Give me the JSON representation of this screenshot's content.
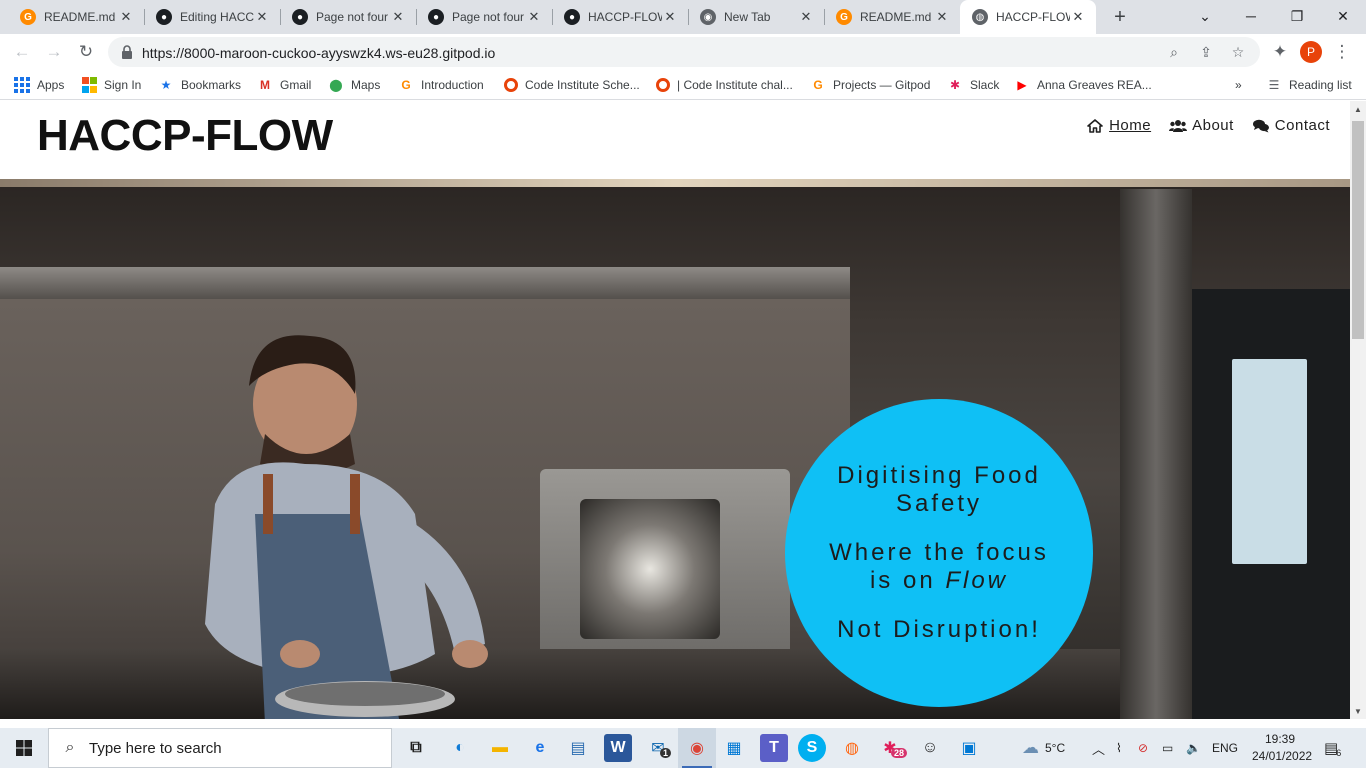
{
  "browser": {
    "tabs": [
      {
        "title": "README.md",
        "icon": "gitpod-icon"
      },
      {
        "title": "Editing HACC",
        "icon": "github-icon"
      },
      {
        "title": "Page not four",
        "icon": "github-icon"
      },
      {
        "title": "Page not four",
        "icon": "github-icon"
      },
      {
        "title": "HACCP-FLOW",
        "icon": "github-icon"
      },
      {
        "title": "New Tab",
        "icon": "chrome-icon"
      },
      {
        "title": "README.md",
        "icon": "gitpod-icon"
      },
      {
        "title": "HACCP-FLOW",
        "icon": "globe-icon",
        "active": true
      }
    ],
    "url": "https://8000-maroon-cuckoo-ayyswzk4.ws-eu28.gitpod.io",
    "profile_initial": "P",
    "bookmarks": [
      {
        "label": "Apps"
      },
      {
        "label": "Sign In"
      },
      {
        "label": "Bookmarks"
      },
      {
        "label": "Gmail"
      },
      {
        "label": "Maps"
      },
      {
        "label": "Introduction"
      },
      {
        "label": "Code Institute Sche..."
      },
      {
        "label": "| Code Institute chal..."
      },
      {
        "label": "Projects — Gitpod"
      },
      {
        "label": "Slack"
      },
      {
        "label": "Anna Greaves REA..."
      }
    ],
    "more_bookmarks": "»",
    "reading_list": "Reading list"
  },
  "site": {
    "title": "HACCP-FLOW",
    "nav": [
      {
        "label": "Home",
        "current": true
      },
      {
        "label": "About"
      },
      {
        "label": "Contact"
      }
    ],
    "hero": {
      "line1": "Digitising Food Safety",
      "line2_prefix": "Where the focus is on ",
      "line2_em": "Flow",
      "line3": "Not Disruption!",
      "circle_color": "#0fc0f5"
    }
  },
  "taskbar": {
    "search_placeholder": "Type here to search",
    "weather": "5°C",
    "language": "ENG",
    "time": "19:39",
    "date": "24/01/2022",
    "mail_badge": "1",
    "slack_badge": "28",
    "notification_count": "6"
  }
}
